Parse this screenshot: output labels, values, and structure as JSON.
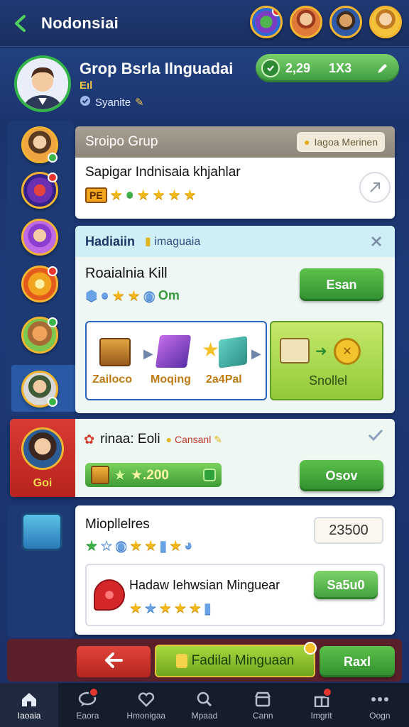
{
  "header": {
    "title": "Nodonsiai"
  },
  "profile": {
    "name": "Grop Bsrla Ilnguadai",
    "sub_badge": "Eıl",
    "status": "Syanite",
    "stat_value": "2,29",
    "stat_ratio": "1X3"
  },
  "group_panel": {
    "header_title": "Sroipo Grup",
    "header_button": "Iagoa Merinen",
    "item_title": "Sapigar Indnisaia khjahlar",
    "item_tag": "PE"
  },
  "quest_panel": {
    "header_title": "Hadiaiin",
    "header_sub": "imaguaia",
    "title": "Roaialnia Kill",
    "meta_text": "Om",
    "action_label": "Esan",
    "steps": [
      "Zailoco",
      "Moqing",
      "2a4Pal"
    ],
    "reward_label": "Snollel"
  },
  "event_panel": {
    "badge_label": "Goi",
    "title": "rinaa: Eoli",
    "sub": "Cansanl",
    "progress_value": "★.200",
    "action_label": "Osov"
  },
  "market_panel": {
    "title": "Miopllelres",
    "price_label": "23500",
    "offer_title": "Hadaw Iehwsian Minguear",
    "offer_button": "Sa5u0"
  },
  "action_bar": {
    "main_label": "Fadilal Minguaan",
    "right_label": "Raxl"
  },
  "nav": {
    "items": [
      {
        "label": "Iaoaia",
        "icon": "home-icon"
      },
      {
        "label": "Eaora",
        "icon": "chat-icon"
      },
      {
        "label": "Hmonigaa",
        "icon": "heart-icon"
      },
      {
        "label": "Mpaad",
        "icon": "search-icon"
      },
      {
        "label": "Cann",
        "icon": "store-icon"
      },
      {
        "label": "Imgrit",
        "icon": "gift-icon"
      },
      {
        "label": "Oogn",
        "icon": "more-icon"
      }
    ]
  },
  "colors": {
    "accent_green": "#3a9a3f",
    "header_blue": "#1c2f63",
    "danger_red": "#c9302c",
    "gold": "#f2b531"
  }
}
